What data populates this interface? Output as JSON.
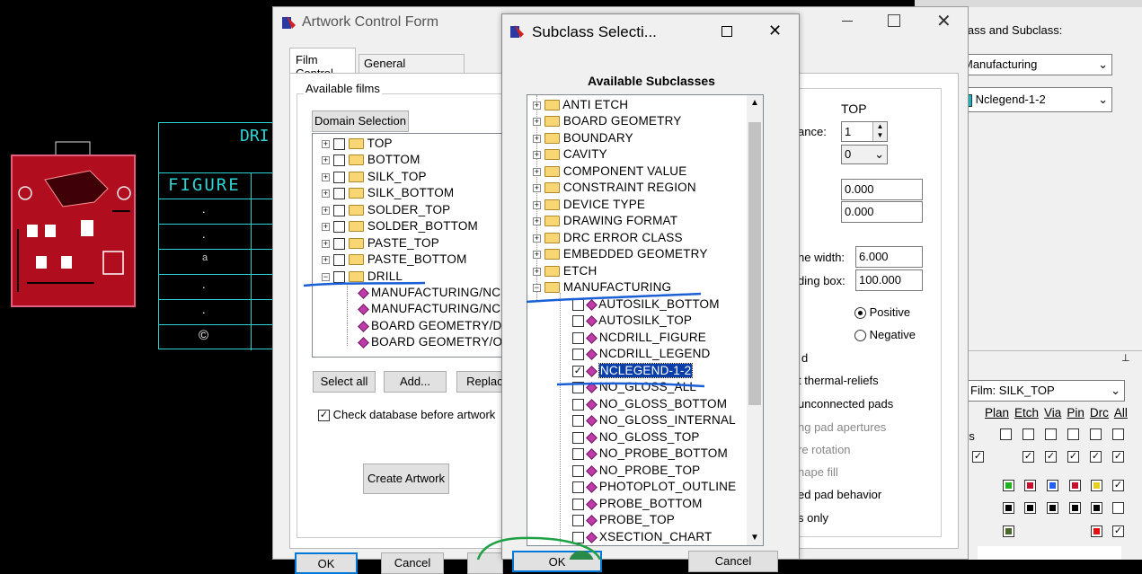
{
  "cad_view": {
    "table_title": "DRI",
    "table_header": "FIGURE",
    "table_symbols": [
      ".",
      ".",
      "a",
      ".",
      ".",
      "©"
    ]
  },
  "artwork_form": {
    "title": "Artwork Control Form",
    "tabs": [
      "Film Control",
      "General Parameters"
    ],
    "available_films_label": "Available films",
    "domain_selection_label": "Domain Selection",
    "films": [
      "TOP",
      "BOTTOM",
      "SILK_TOP",
      "SILK_BOTTOM",
      "SOLDER_TOP",
      "SOLDER_BOTTOM",
      "PASTE_TOP",
      "PASTE_BOTTOM",
      "DRILL"
    ],
    "drill_children": [
      "MANUFACTURING/NCD",
      "MANUFACTURING/NCD",
      "BOARD GEOMETRY/DI",
      "BOARD GEOMETRY/OU"
    ],
    "select_all_label": "Select all",
    "add_label": "Add...",
    "replace_label": "Replace",
    "check_db_label": "Check database before artwork",
    "create_artwork_label": "Create Artwork",
    "top_label": "TOP",
    "ance_label": "ance:",
    "spin_value": "1",
    "combo_value": "0",
    "field1": "0.000",
    "field2": "0.000",
    "line_width_label": "ne width:",
    "line_width_value": "6.000",
    "bounding_box_label": "ding box:",
    "bounding_box_value": "100.000",
    "positive_label": "Positive",
    "negative_label": "Negative",
    "opt_d": "d",
    "opt_thermal": "t thermal-reliefs",
    "opt_unconnected": "unconnected pads",
    "opt_apertures": "ng pad apertures",
    "opt_rotation": "re rotation",
    "opt_shape_fill": "hape fill",
    "opt_pad_behavior": "ed pad behavior",
    "opt_only": "s only",
    "ok_label": "OK",
    "cancel_label": "Cancel"
  },
  "subclass_dialog": {
    "title": "Subclass Selecti...",
    "header": "Available Subclasses",
    "folders": [
      "ANTI ETCH",
      "BOARD GEOMETRY",
      "BOUNDARY",
      "CAVITY",
      "COMPONENT VALUE",
      "CONSTRAINT REGION",
      "DEVICE TYPE",
      "DRAWING FORMAT",
      "DRC ERROR CLASS",
      "EMBEDDED GEOMETRY",
      "ETCH",
      "MANUFACTURING"
    ],
    "subclasses": [
      "AUTOSILK_BOTTOM",
      "AUTOSILK_TOP",
      "NCDRILL_FIGURE",
      "NCDRILL_LEGEND",
      "NCLEGEND-1-2",
      "NO_GLOSS_ALL",
      "NO_GLOSS_BOTTOM",
      "NO_GLOSS_INTERNAL",
      "NO_GLOSS_TOP",
      "NO_PROBE_BOTTOM",
      "NO_PROBE_TOP",
      "PHOTOPLOT_OUTLINE",
      "PROBE_BOTTOM",
      "PROBE_TOP",
      "XSECTION_CHART"
    ],
    "checked_subclass": "NCLEGEND-1-2",
    "ok_label": "OK",
    "cancel_label": "Cancel"
  },
  "right_panel": {
    "class_subclass_label": "lass and Subclass:",
    "class_value": "Manufacturing",
    "subclass_value": "Nclegend-1-2",
    "film_value": "Film: SILK_TOP",
    "columns": [
      "Plan",
      "Etch",
      "Via",
      "Pin",
      "Drc",
      "All"
    ],
    "row_label": "rs"
  },
  "colors": {
    "annotation_blue": "#1a5fd6",
    "annotation_green": "#1fa045",
    "cad_cyan": "#2bd3d3",
    "pcb_red": "#c0182a",
    "selection_blue": "#0a3ea8"
  }
}
